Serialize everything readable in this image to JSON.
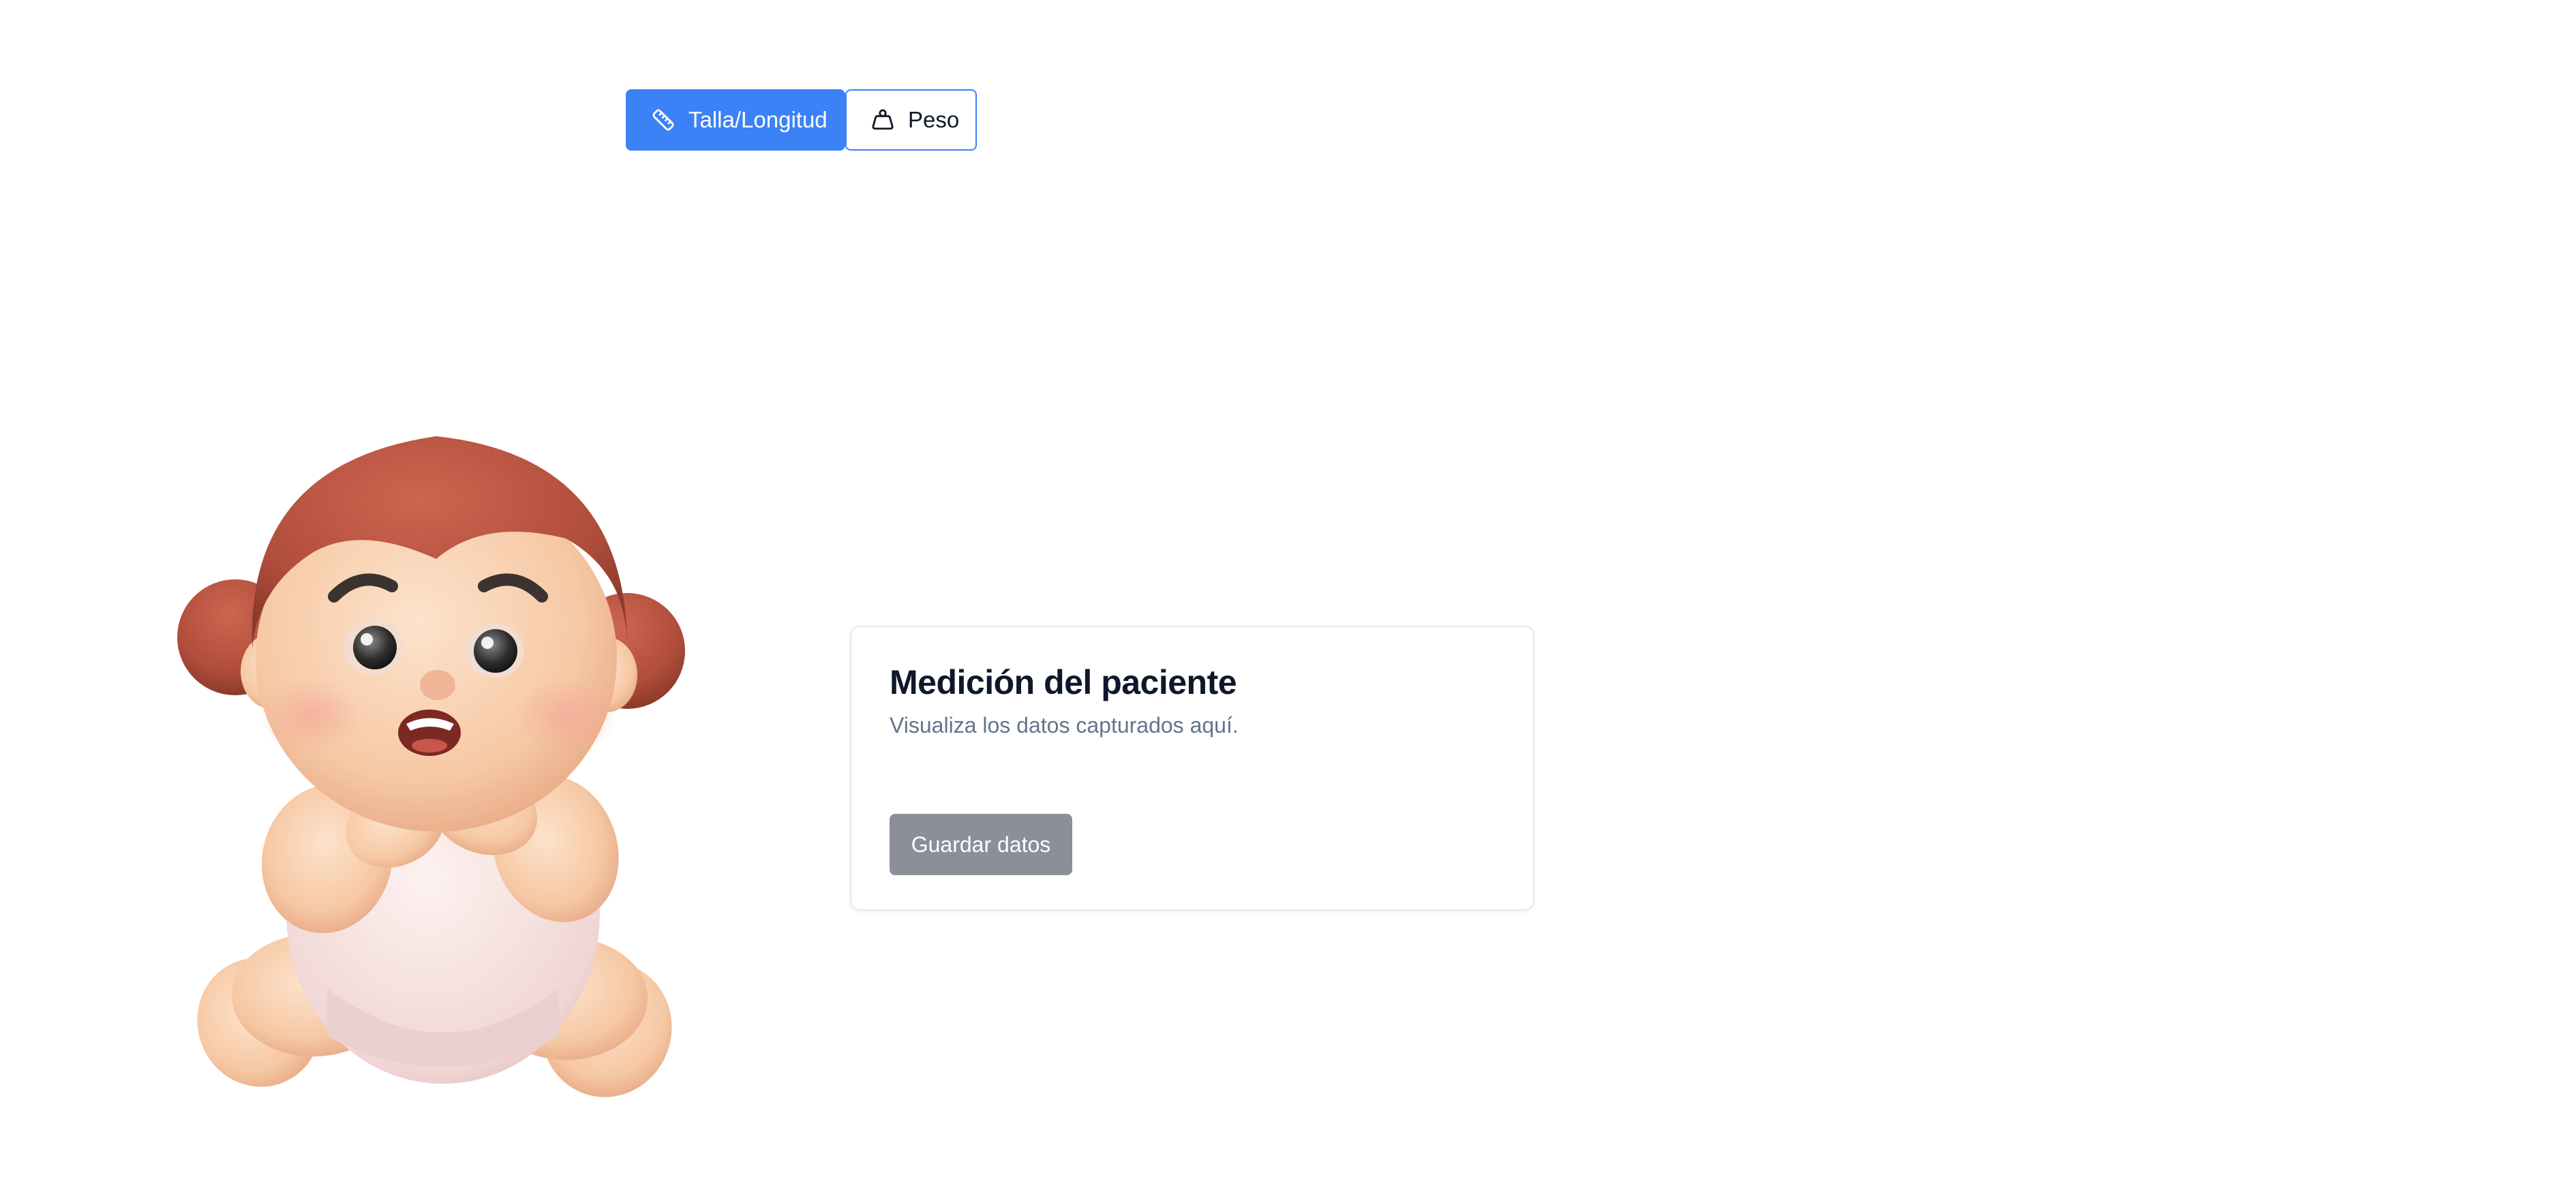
{
  "tabs": {
    "length": {
      "label": "Talla/Longitud",
      "icon": "ruler-icon",
      "active": true
    },
    "weight": {
      "label": "Peso",
      "icon": "weight-icon",
      "active": false
    }
  },
  "card": {
    "title": "Medición del paciente",
    "subtitle": "Visualiza los datos capturados aquí.",
    "save_label": "Guardar datos"
  },
  "illustration": {
    "name": "baby-illustration"
  },
  "colors": {
    "accent": "#3b82f6",
    "disabled_button": "#8a8f98",
    "card_border": "#e5e7eb",
    "subtitle": "#64748b",
    "title": "#0f172a"
  }
}
